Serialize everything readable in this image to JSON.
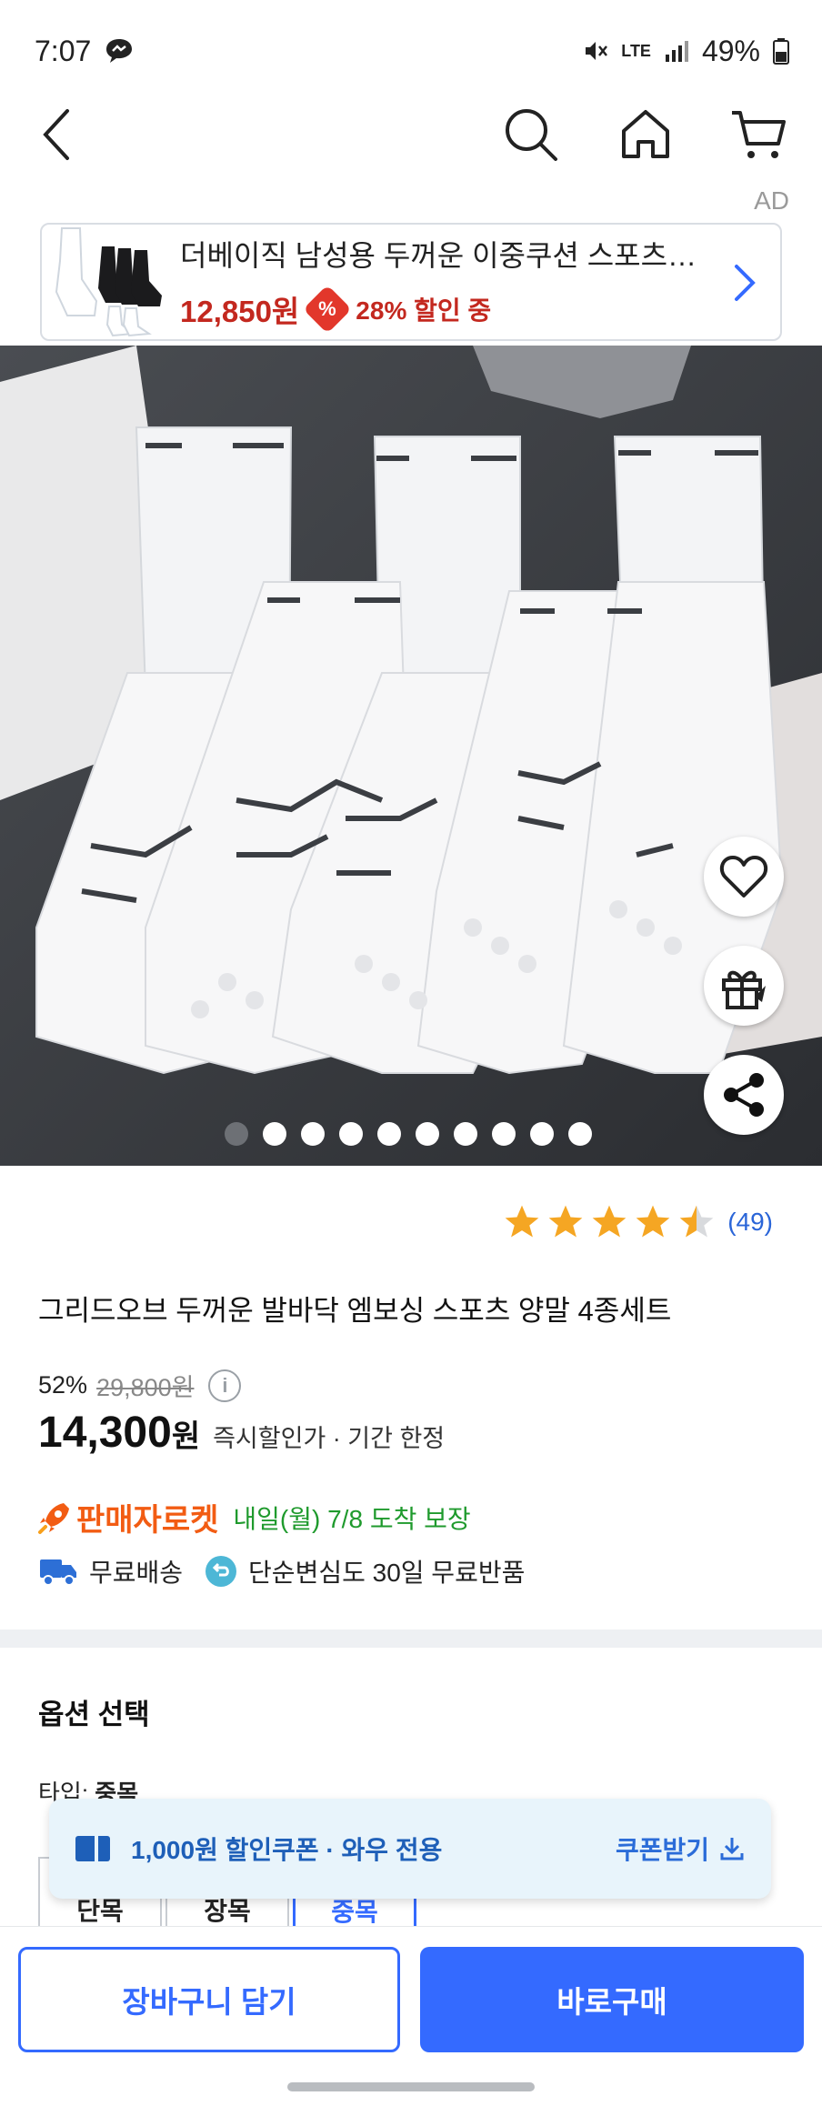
{
  "status_bar": {
    "time": "7:07",
    "network": "LTE",
    "battery": "49%"
  },
  "ad_label": "AD",
  "banner": {
    "title": "더베이직 남성용 두꺼운 이중쿠션 스포츠…",
    "price": "12,850원",
    "badge": "%",
    "discount": "28% 할인 중"
  },
  "carousel": {
    "total_images": 10,
    "active_index": 0
  },
  "product": {
    "rating": 4.5,
    "review_count": "(49)",
    "title": "그리드오브 두꺼운 발바닥 엠보싱 스포츠 양말 4종세트",
    "discount_rate": "52%",
    "original_price": "29,800원",
    "info": "i",
    "sale_price": "14,300",
    "sale_unit": "원",
    "price_note": "즉시할인가 · 기간 한정"
  },
  "delivery": {
    "brand": "판매자로켓",
    "eta": "내일(월) 7/8 도착 보장",
    "free_shipping": "무료배송",
    "returns": "단순변심도 30일 무료반품"
  },
  "options": {
    "section_title": "옵션 선택",
    "type_label": "타입: ",
    "type_value": "중목",
    "choices": [
      "단목",
      "장목",
      "중목"
    ],
    "selected": "중목"
  },
  "coupon": {
    "text": "1,000원 할인쿠폰 · 와우 전용",
    "action": "쿠폰받기"
  },
  "bottom": {
    "cart_button": "장바구니 담기",
    "buy_button": "바로구매"
  },
  "colors": {
    "primary_blue": "#346aff",
    "price_red": "#c3281f",
    "rocket_orange": "#f25c13",
    "delivery_green": "#1f9a2d",
    "coupon_bg": "#e8f4fb"
  }
}
